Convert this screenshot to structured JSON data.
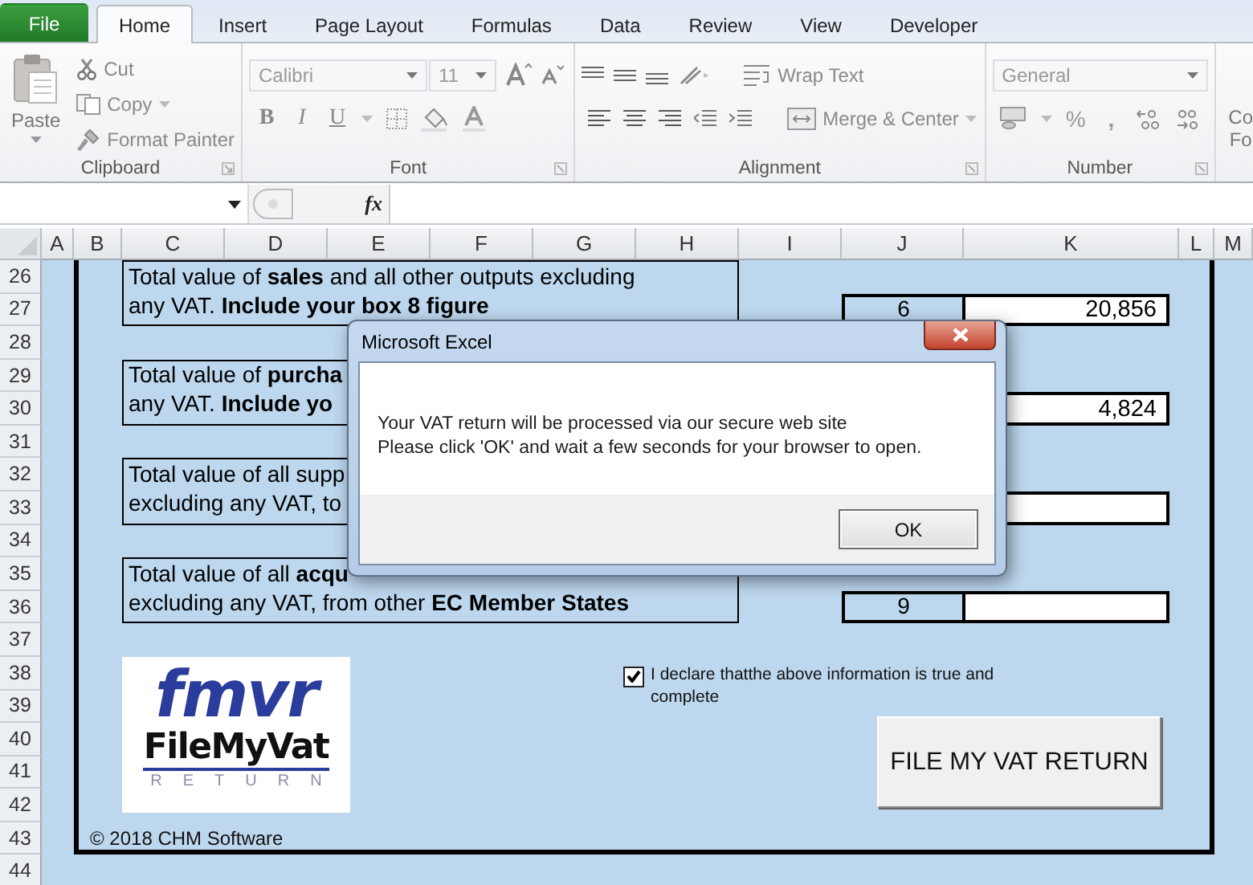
{
  "ribbon_tabs": [
    {
      "label": "File",
      "kind": "file",
      "selected": false
    },
    {
      "label": "Home",
      "kind": "tab",
      "selected": true
    },
    {
      "label": "Insert",
      "kind": "tab",
      "selected": false
    },
    {
      "label": "Page Layout",
      "kind": "tab",
      "selected": false
    },
    {
      "label": "Formulas",
      "kind": "tab",
      "selected": false
    },
    {
      "label": "Data",
      "kind": "tab",
      "selected": false
    },
    {
      "label": "Review",
      "kind": "tab",
      "selected": false
    },
    {
      "label": "View",
      "kind": "tab",
      "selected": false
    },
    {
      "label": "Developer",
      "kind": "tab",
      "selected": false
    }
  ],
  "clipboard": {
    "label": "Clipboard",
    "paste": "Paste",
    "cut": "Cut",
    "copy": "Copy",
    "format_painter": "Format Painter"
  },
  "font": {
    "label": "Font",
    "font_name": "Calibri",
    "font_size": "11",
    "style_buttons": [
      "B",
      "I",
      "U"
    ]
  },
  "alignment": {
    "label": "Alignment",
    "wrap_text": "Wrap Text",
    "merge_center": "Merge & Center"
  },
  "number": {
    "label": "Number",
    "format": "General",
    "percent": "%",
    "comma": ","
  },
  "styles_cut": [
    "Co",
    "Fo"
  ],
  "formula_bar": {
    "fx_label": "fx"
  },
  "columns": [
    "A",
    "B",
    "C",
    "D",
    "E",
    "F",
    "G",
    "H",
    "I",
    "J",
    "K",
    "L",
    "M"
  ],
  "rows": [
    "26",
    "27",
    "28",
    "29",
    "30",
    "31",
    "32",
    "33",
    "34",
    "35",
    "36",
    "37",
    "38",
    "39",
    "40",
    "41",
    "42",
    "43",
    "44"
  ],
  "questions": [
    {
      "lines": [
        "Total value of **sales** and all other outputs excluding",
        "any VAT. **Include your box 8 figure**"
      ]
    },
    {
      "lines": [
        "Total value of **purcha**",
        "any VAT. **Include yo**"
      ]
    },
    {
      "lines": [
        "Total value of all supp",
        "excluding any VAT, to"
      ]
    },
    {
      "lines": [
        "Total value of all **acqu**",
        "excluding any VAT, from other **EC Member States**"
      ]
    }
  ],
  "answers": [
    {
      "kind": "amount",
      "box_number": "6",
      "value": "20,856"
    },
    {
      "kind": "amount",
      "value": "4,824"
    },
    {
      "kind": "amount"
    },
    {
      "kind": "amount",
      "box_number": "9"
    }
  ],
  "logo": {
    "mark": "fmvr",
    "wordmark": "FileMyVat",
    "tagline": "RETURN"
  },
  "declaration": {
    "label": "I declare thatthe above information is true and complete",
    "checked": true
  },
  "file_button": "FILE MY VAT RETURN",
  "copyright": "© 2018 CHM Software",
  "dialog": {
    "title": "Microsoft Excel",
    "message": [
      "Your VAT return will be processed via our secure web site",
      "Please click 'OK' and wait a few seconds for your browser to open."
    ],
    "button": "OK"
  }
}
